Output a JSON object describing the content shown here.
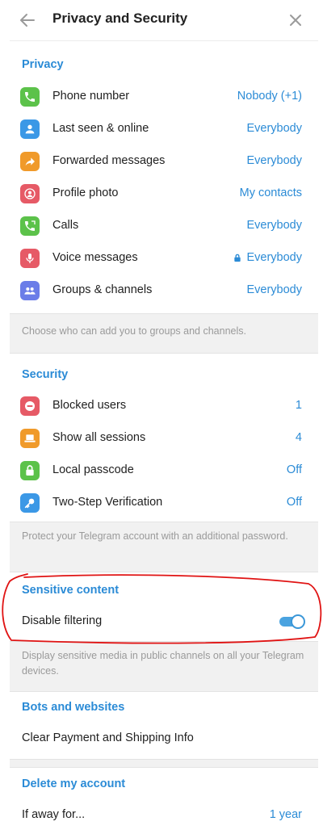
{
  "header": {
    "title": "Privacy and Security"
  },
  "privacy": {
    "title": "Privacy",
    "items": [
      {
        "label": "Phone number",
        "value": "Nobody (+1)",
        "color": "#5cc24a",
        "icon": "phone-icon"
      },
      {
        "label": "Last seen & online",
        "value": "Everybody",
        "color": "#3b98e6",
        "icon": "person-icon"
      },
      {
        "label": "Forwarded messages",
        "value": "Everybody",
        "color": "#f09a2a",
        "icon": "forward-icon"
      },
      {
        "label": "Profile photo",
        "value": "My contacts",
        "color": "#e65a66",
        "icon": "profile-icon"
      },
      {
        "label": "Calls",
        "value": "Everybody",
        "color": "#5cc24a",
        "icon": "call-icon"
      },
      {
        "label": "Voice messages",
        "value": "Everybody",
        "color": "#e65a66",
        "icon": "microphone-icon",
        "locked": true
      },
      {
        "label": "Groups & channels",
        "value": "Everybody",
        "color": "#6b7de8",
        "icon": "group-icon"
      }
    ],
    "note": "Choose who can add you to groups and channels."
  },
  "security": {
    "title": "Security",
    "items": [
      {
        "label": "Blocked users",
        "value": "1",
        "color": "#e65a66",
        "icon": "blocked-icon"
      },
      {
        "label": "Show all sessions",
        "value": "4",
        "color": "#f09a2a",
        "icon": "laptop-icon"
      },
      {
        "label": "Local passcode",
        "value": "Off",
        "color": "#5cc24a",
        "icon": "lock-icon"
      },
      {
        "label": "Two-Step Verification",
        "value": "Off",
        "color": "#3b98e6",
        "icon": "key-icon"
      }
    ],
    "note": "Protect your Telegram account with an additional password."
  },
  "sensitive": {
    "title": "Sensitive content",
    "toggle_label": "Disable filtering",
    "toggle_on": true,
    "note": "Display sensitive media in public channels on all your Telegram devices."
  },
  "bots": {
    "title": "Bots and websites",
    "clear_label": "Clear Payment and Shipping Info"
  },
  "delete": {
    "title": "Delete my account",
    "away_label": "If away for...",
    "away_value": "1 year"
  }
}
